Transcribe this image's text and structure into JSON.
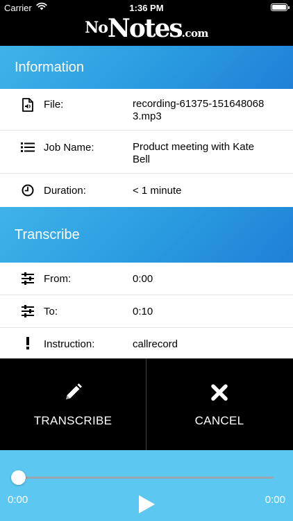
{
  "status_bar": {
    "carrier": "Carrier",
    "time": "1:36 PM"
  },
  "app": {
    "logo_part1": "No",
    "logo_part2": "Notes",
    "logo_part3": ".com"
  },
  "information": {
    "title": "Information",
    "rows": [
      {
        "icon": "audio-file-icon",
        "label": "File:",
        "value": "recording-61375-151648068 3.mp3"
      },
      {
        "icon": "list-icon",
        "label": "Job Name:",
        "value": "Product meeting with Kate Bell"
      },
      {
        "icon": "clock-icon",
        "label": "Duration:",
        "value": "< 1 minute"
      }
    ]
  },
  "transcribe": {
    "title": "Transcribe",
    "rows": [
      {
        "icon": "sliders-icon",
        "label": "From:",
        "value": "0:00"
      },
      {
        "icon": "sliders-icon",
        "label": "To:",
        "value": "0:10"
      },
      {
        "icon": "exclamation-icon",
        "label": "Instruction:",
        "value": "callrecord"
      }
    ]
  },
  "actions": {
    "transcribe_label": "TRANSCRIBE",
    "cancel_label": "CANCEL"
  },
  "player": {
    "current_time": "0:00",
    "total_time": "0:00",
    "progress": 0
  },
  "colors": {
    "header_bg": "#000000",
    "section_blue": "#2a9ae0",
    "player_bg": "#5cc8f2",
    "actions_bg": "#000000"
  }
}
